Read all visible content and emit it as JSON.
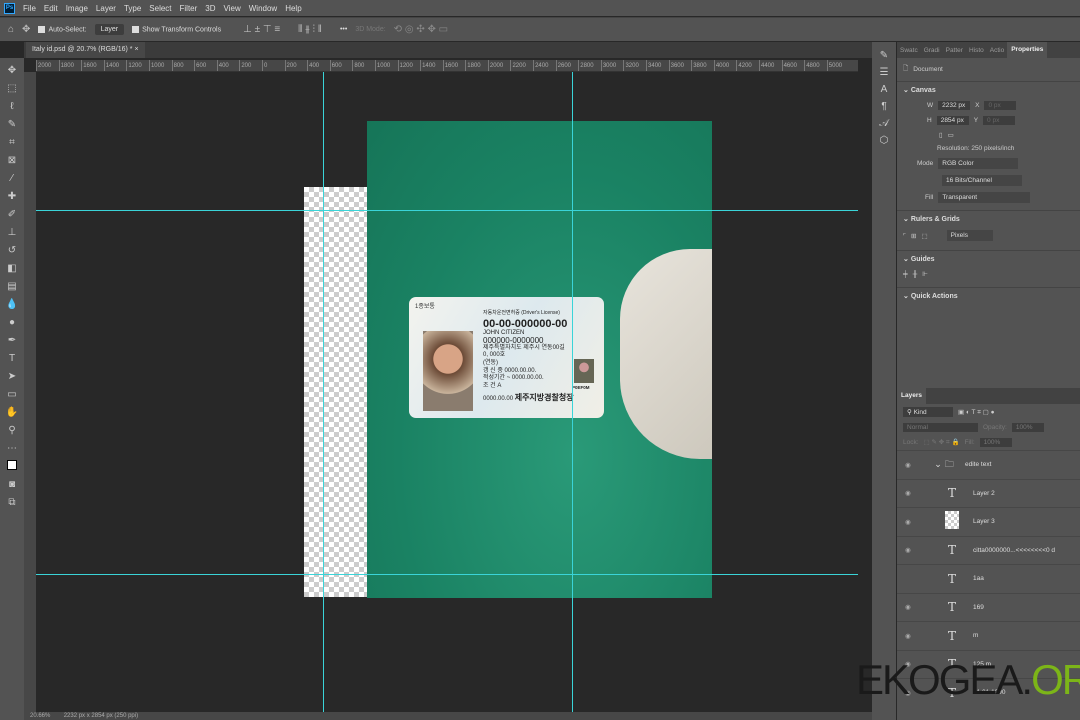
{
  "menu": [
    "File",
    "Edit",
    "Image",
    "Layer",
    "Type",
    "Select",
    "Filter",
    "3D",
    "View",
    "Window",
    "Help"
  ],
  "options": {
    "auto_select": "Auto-Select:",
    "target": "Layer",
    "show_transform": "Show Transform Controls",
    "more": "•••",
    "mode_3d": "3D Mode:"
  },
  "doc_tab": "Italy id.psd @ 20.7% (RGB/16) *",
  "ruler_ticks": [
    "2000",
    "1800",
    "1600",
    "1400",
    "1200",
    "1000",
    "800",
    "600",
    "400",
    "200",
    "0",
    "200",
    "400",
    "600",
    "800",
    "1000",
    "1200",
    "1400",
    "1600",
    "1800",
    "2000",
    "2200",
    "2400",
    "2600",
    "2800",
    "3000",
    "3200",
    "3400",
    "3600",
    "3800",
    "4000",
    "4200",
    "4400",
    "4600",
    "4800",
    "5000"
  ],
  "status": {
    "zoom": "20.66%",
    "info": "2232 px x 2854 px (250 ppi)"
  },
  "card": {
    "type": "1종보통",
    "title": "자동차운전면허증 (Driver's License)",
    "number": "00-00-000000-00",
    "name": "JOHN CITIZEN",
    "id": "000000-0000000",
    "addr1": "제주특별자치도 제주시 연동00길",
    "addr2": "0, 000호",
    "addr3": "(연동)",
    "renew": "갱 신 중   0000.00.00.",
    "period": "적성기간   ~ 0000.00.00.",
    "cond": "조    건  A",
    "issued": "0000.00.00",
    "issuer": "제주지방경찰청장",
    "code": "P0EF0M"
  },
  "properties": {
    "tabs": [
      "Swatc",
      "Gradi",
      "Patter",
      "Histo",
      "Actio",
      "Properties"
    ],
    "doc": "Document",
    "canvas": "Canvas",
    "w_label": "W",
    "w": "2232 px",
    "h_label": "H",
    "h": "2854 px",
    "x_label": "X",
    "x": "0 px",
    "y_label": "Y",
    "y": "0 px",
    "resolution": "Resolution: 250 pixels/inch",
    "mode_label": "Mode",
    "mode": "RGB Color",
    "depth": "16 Bits/Channel",
    "fill_label": "Fill",
    "fill": "Transparent",
    "rulers": "Rulers & Grids",
    "units": "Pixels",
    "guides": "Guides",
    "quick": "Quick Actions"
  },
  "layers": {
    "title": "Layers",
    "filter": "Kind",
    "blend": "Normal",
    "opacity_label": "Opacity:",
    "opacity": "100%",
    "lock_label": "Lock:",
    "fill_label": "Fill:",
    "fill": "100%",
    "items": [
      {
        "name": "edite text",
        "kind": "group"
      },
      {
        "name": "Layer 2",
        "kind": "text"
      },
      {
        "name": "Layer 3",
        "kind": "pixel"
      },
      {
        "name": "citta0000000...<<<<<<<<0 d",
        "kind": "text"
      },
      {
        "name": "1aa",
        "kind": "text",
        "hidden": true
      },
      {
        "name": "169",
        "kind": "text"
      },
      {
        "name": "m",
        "kind": "text"
      },
      {
        "name": "125 m",
        "kind": "text"
      },
      {
        "name": "01.01.1990",
        "kind": "text"
      }
    ]
  },
  "watermark": {
    "a": "EKOGEA.",
    "b": "ORG"
  },
  "colors": {
    "guide": "#3ad4d8",
    "ui": "#535353",
    "canvas": "#282828",
    "accent": "#7cb518"
  }
}
